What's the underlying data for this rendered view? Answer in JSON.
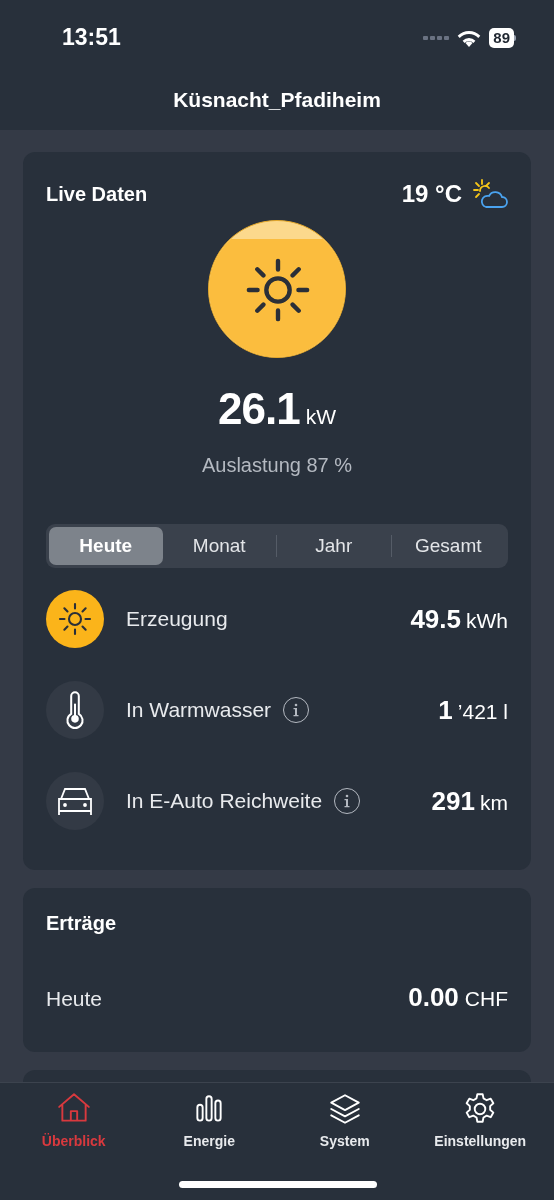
{
  "status_bar": {
    "time": "13:51",
    "battery": "89"
  },
  "title": "Küsnacht_Pfadiheim",
  "live": {
    "title": "Live Daten",
    "temperature": "19 °C",
    "power_value": "26.1",
    "power_unit": "kW",
    "utilization": "Auslastung 87 %"
  },
  "periods": [
    {
      "label": "Heute",
      "selected": true
    },
    {
      "label": "Monat",
      "selected": false
    },
    {
      "label": "Jahr",
      "selected": false
    },
    {
      "label": "Gesamt",
      "selected": false
    }
  ],
  "metrics": [
    {
      "kind": "sun",
      "label": "Erzeugung",
      "info": false,
      "value": "49.5",
      "unit": "kWh"
    },
    {
      "kind": "thermometer",
      "label": "In Warmwasser",
      "info": true,
      "value": "1",
      "unit": "’421 l"
    },
    {
      "kind": "car",
      "label": "In E-Auto Reichweite",
      "info": true,
      "value": "291",
      "unit": "km"
    }
  ],
  "earnings": {
    "title": "Erträge",
    "rows": [
      {
        "label": "Heute",
        "value": "0.00",
        "unit": "CHF"
      }
    ]
  },
  "nav": [
    {
      "kind": "home",
      "label": "Überblick",
      "selected": true
    },
    {
      "kind": "chart",
      "label": "Energie",
      "selected": false
    },
    {
      "kind": "layers",
      "label": "System",
      "selected": false
    },
    {
      "kind": "gear",
      "label": "Einstellungen",
      "selected": false
    }
  ]
}
